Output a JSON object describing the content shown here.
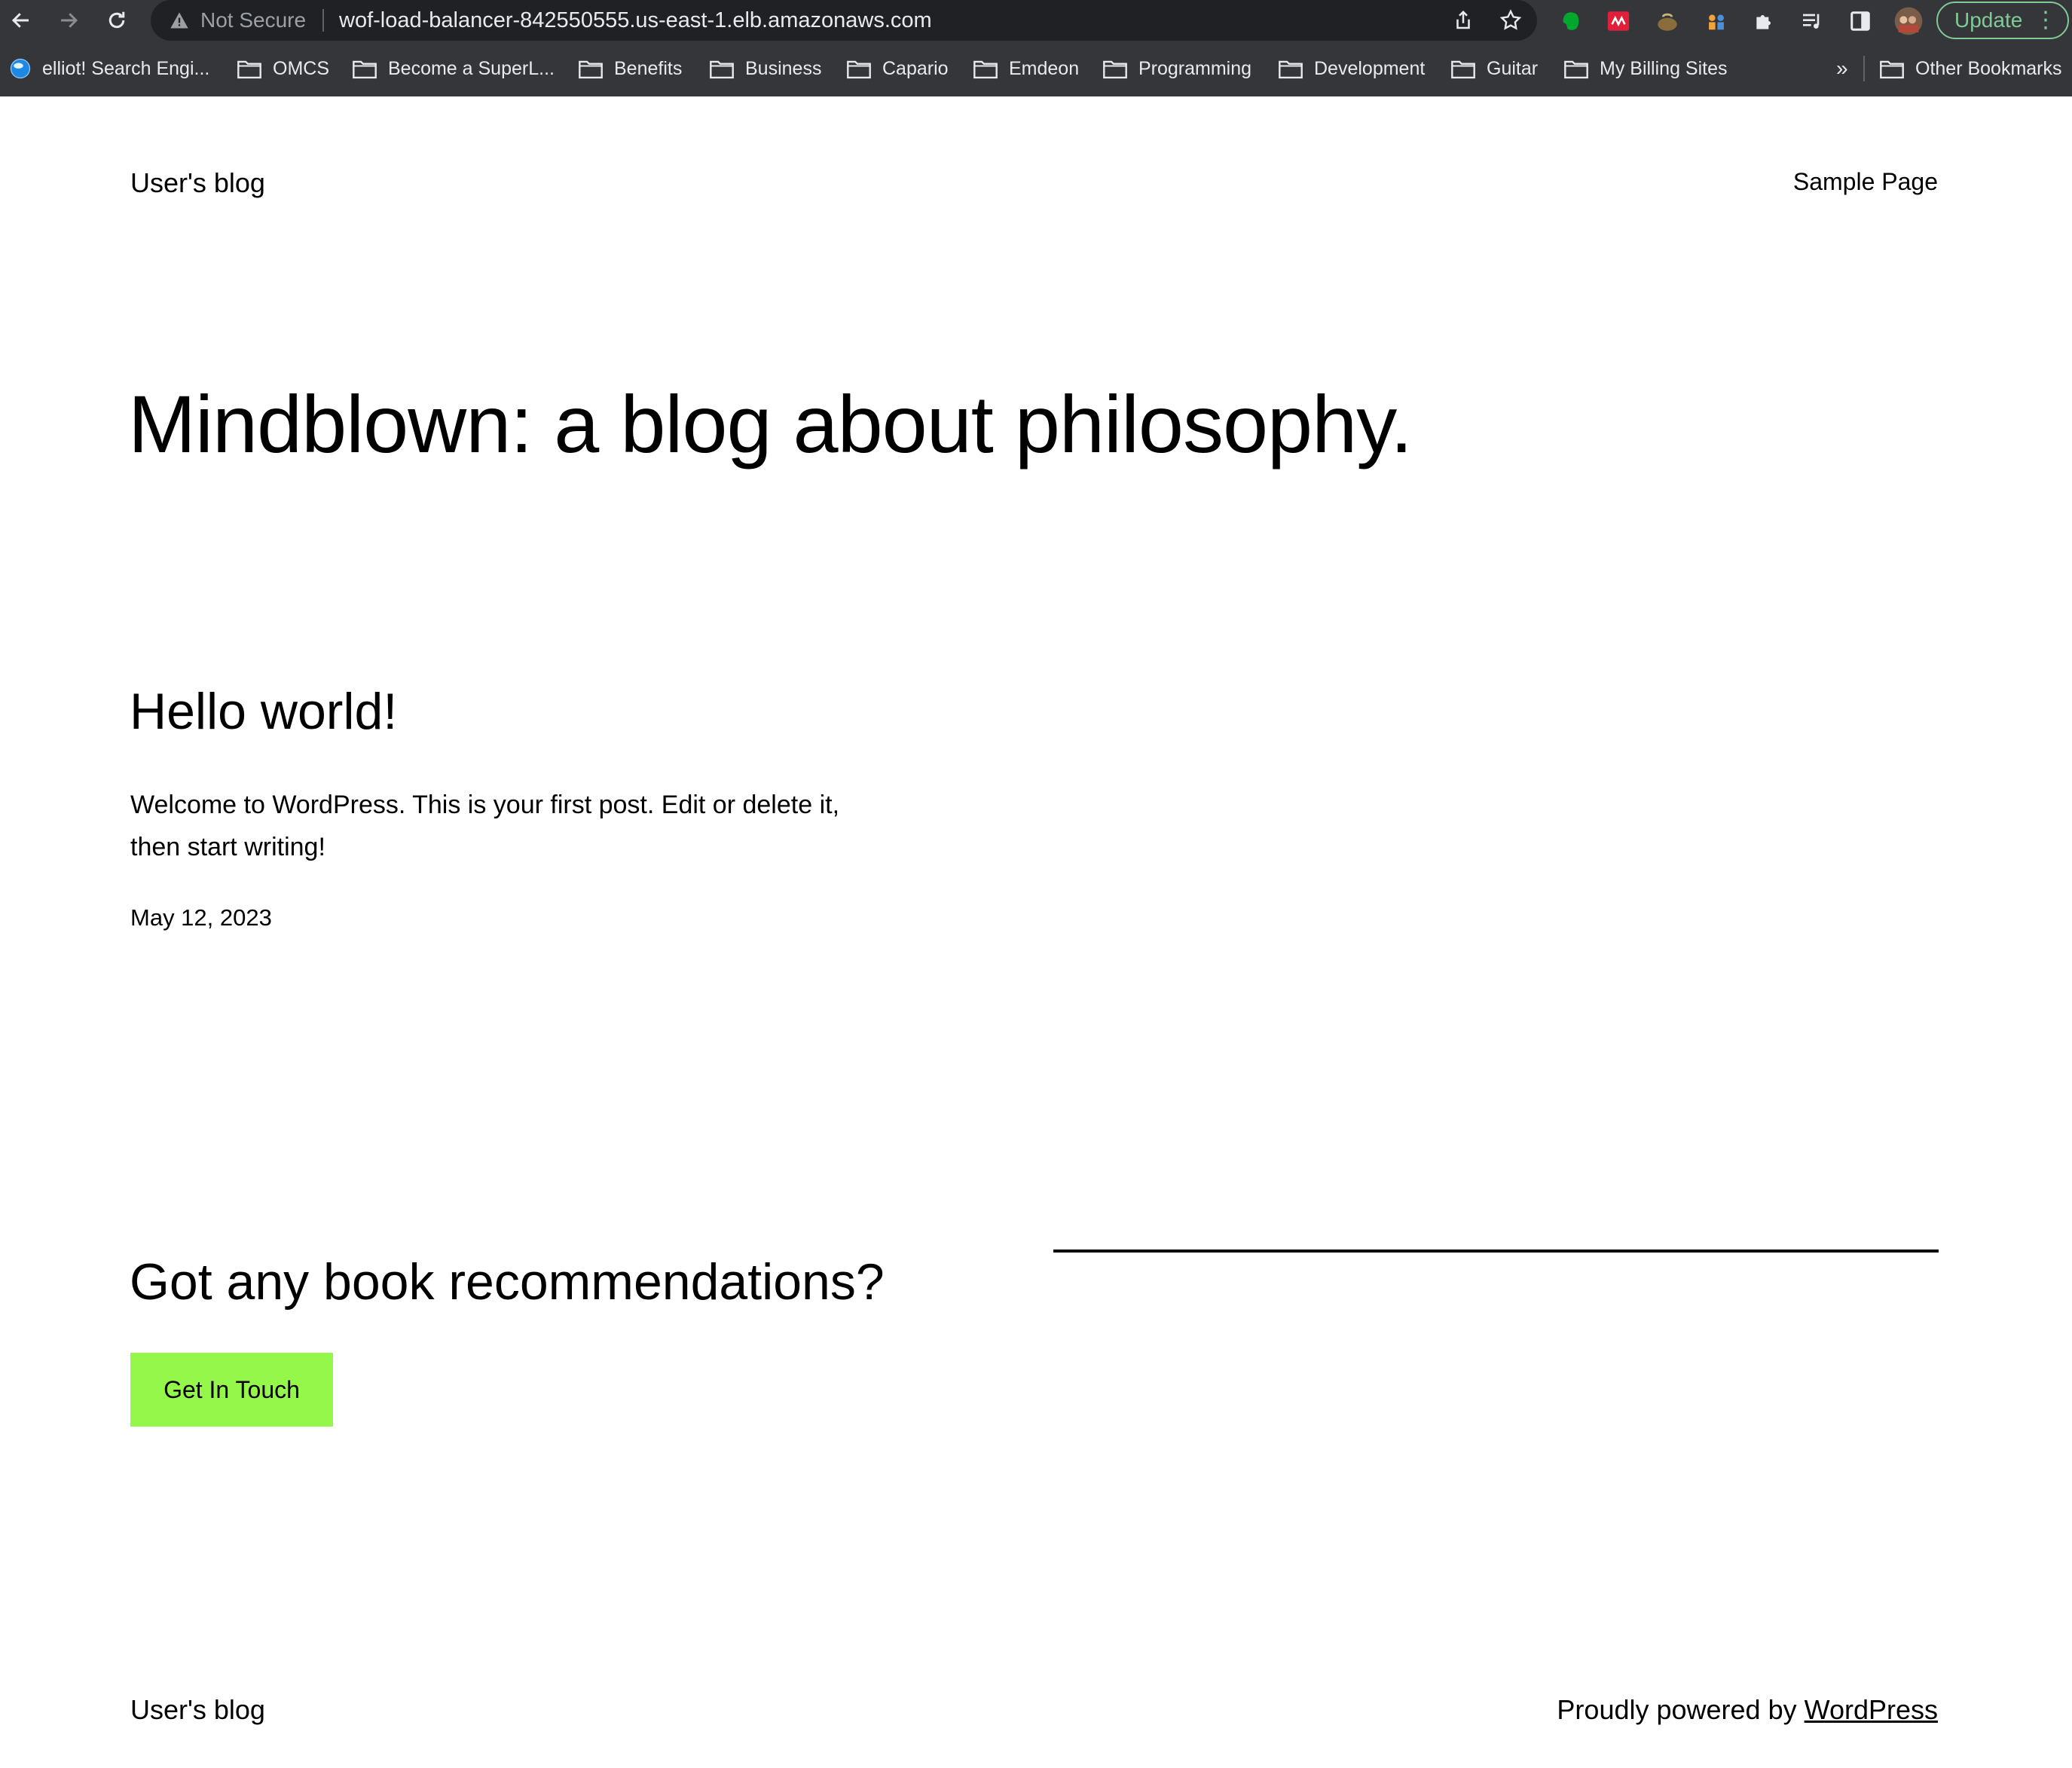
{
  "browser": {
    "security_label": "Not Secure",
    "url": "wof-load-balancer-842550555.us-east-1.elb.amazonaws.com",
    "update_label": "Update",
    "bookmarks": [
      {
        "label": "elliot! Search Engi...",
        "icon": "globe-icon"
      },
      {
        "label": "OMCS",
        "icon": "folder-icon"
      },
      {
        "label": "Become a SuperL...",
        "icon": "folder-icon"
      },
      {
        "label": "Benefits",
        "icon": "folder-icon"
      },
      {
        "label": "Business",
        "icon": "folder-icon"
      },
      {
        "label": "Capario",
        "icon": "folder-icon"
      },
      {
        "label": "Emdeon",
        "icon": "folder-icon"
      },
      {
        "label": "Programming",
        "icon": "folder-icon"
      },
      {
        "label": "Development",
        "icon": "folder-icon"
      },
      {
        "label": "Guitar",
        "icon": "folder-icon"
      },
      {
        "label": "My Billing Sites",
        "icon": "folder-icon"
      }
    ],
    "overflow_label": "»",
    "other_bookmarks_label": "Other Bookmarks"
  },
  "header": {
    "site_title": "User's blog",
    "nav": [
      "Sample Page"
    ]
  },
  "hero": {
    "title": "Mindblown: a blog about philosophy."
  },
  "post": {
    "title": "Hello world!",
    "excerpt": "Welcome to WordPress. This is your first post. Edit or delete it, then start writing!",
    "date": "May 12, 2023"
  },
  "cta": {
    "title": "Got any book recommendations?",
    "button_label": "Get In Touch",
    "button_color": "#95f74a"
  },
  "footer": {
    "site_title": "User's blog",
    "powered_prefix": "Proudly powered by ",
    "powered_link": "WordPress"
  }
}
